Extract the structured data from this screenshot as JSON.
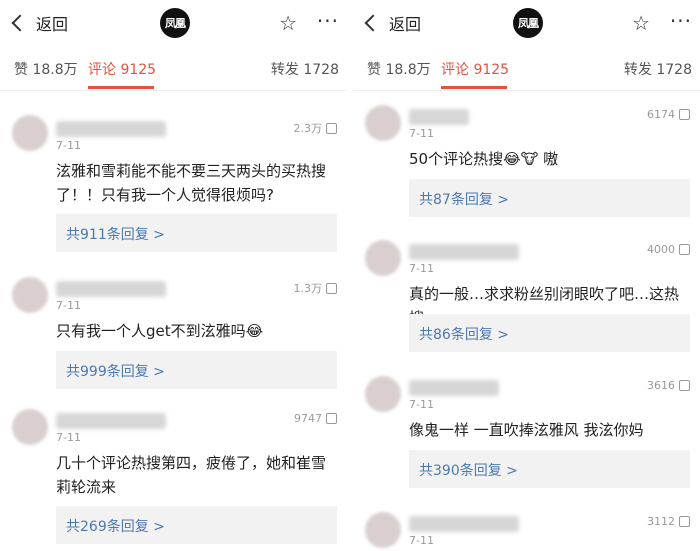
{
  "panels": [
    {
      "header": {
        "back_label": "返回",
        "logo_text": "凤凰",
        "star_icon": "star-outline-icon",
        "more_icon": "more-dots-icon"
      },
      "tabs": {
        "likes": "赞 18.8万",
        "comments": "评论 9125",
        "reposts": "转发 1728"
      },
      "comments": [
        {
          "date": "7-11",
          "likes": "2.3万",
          "text": "泫雅和雪莉能不能不要三天两头的买热搜了！！只有我一个人觉得很烦吗?",
          "replies": "共911条回复 >"
        },
        {
          "date": "7-11",
          "likes": "1.3万",
          "text": "只有我一个人get不到泫雅吗😂",
          "replies": "共999条回复 >"
        },
        {
          "date": "7-11",
          "likes": "9747",
          "text": "几十个评论热搜第四，疲倦了，她和崔雪莉轮流来",
          "replies": "共269条回复 >"
        }
      ]
    },
    {
      "header": {
        "back_label": "返回",
        "logo_text": "凤凰",
        "star_icon": "star-outline-icon",
        "more_icon": "more-dots-icon"
      },
      "tabs": {
        "likes": "赞 18.8万",
        "comments": "评论 9125",
        "reposts": "转发 1728"
      },
      "comments": [
        {
          "date": "7-11",
          "likes": "6174",
          "text": "50个评论热搜😂🐮 嗷",
          "replies": "共87条回复 >"
        },
        {
          "date": "7-11",
          "likes": "4000",
          "text": "真的一般…求求粉丝别闭眼吹了吧…这热搜",
          "replies": "共86条回复 >"
        },
        {
          "date": "7-11",
          "likes": "3616",
          "text": "像鬼一样 一直吹捧泫雅风 我泫你妈",
          "replies": "共390条回复 >"
        },
        {
          "date": "7-11",
          "likes": "3112",
          "text": "",
          "replies": ""
        }
      ]
    }
  ]
}
